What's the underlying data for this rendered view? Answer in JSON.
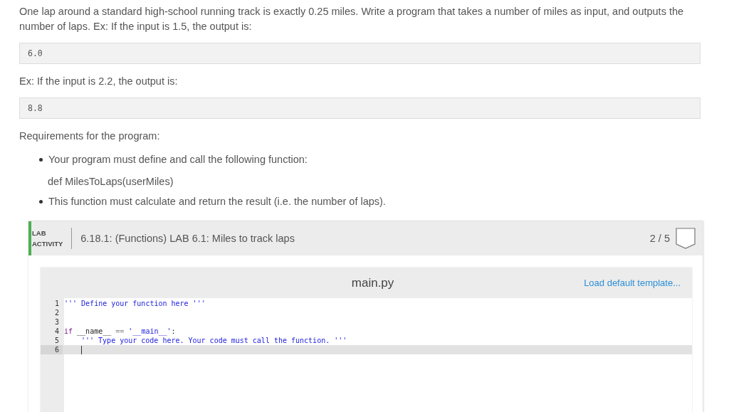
{
  "intro": "One lap around a standard high-school running track is exactly 0.25 miles. Write a program that takes a number of miles as input, and outputs the number of laps. Ex: If the input is 1.5, the output is:",
  "example_1": "6.0",
  "example_2_intro": "Ex: If the input is 2.2, the output is:",
  "example_2": "8.8",
  "requirements_heading": "Requirements for the program:",
  "requirements": [
    {
      "text": "Your program must define and call the following function:",
      "note": "def MilesToLaps(userMiles)"
    },
    {
      "text": "This function must calculate and return the result (i.e. the number of laps)."
    }
  ],
  "lab": {
    "label_line_1": "LAB",
    "label_line_2": "ACTIVITY",
    "title": "6.18.1: (Functions) LAB 6.1: Miles to track laps",
    "score": "2 / 5"
  },
  "editor": {
    "filename": "main.py",
    "load_template": "Load default template...",
    "lines": [
      {
        "number": "1",
        "active": false,
        "tokens": [
          {
            "text": "''' Define your function here '''",
            "kind": "string"
          }
        ]
      },
      {
        "number": "2",
        "active": false
      },
      {
        "number": "3",
        "active": false
      },
      {
        "number": "4",
        "active": false,
        "tokens": [
          {
            "text": "if",
            "kind": "keyword"
          },
          {
            "text": " __name__ ",
            "kind": "plain"
          },
          {
            "text": "==",
            "kind": "operator"
          },
          {
            "text": " '__main__'",
            "kind": "string"
          },
          {
            "text": ":",
            "kind": "plain"
          }
        ]
      },
      {
        "number": "5",
        "active": false,
        "indented": true,
        "tokens": [
          {
            "text": "''' Type your code here. Your code must call the function. '''",
            "kind": "string"
          }
        ]
      },
      {
        "number": "6",
        "active": true,
        "indented": true
      }
    ]
  }
}
